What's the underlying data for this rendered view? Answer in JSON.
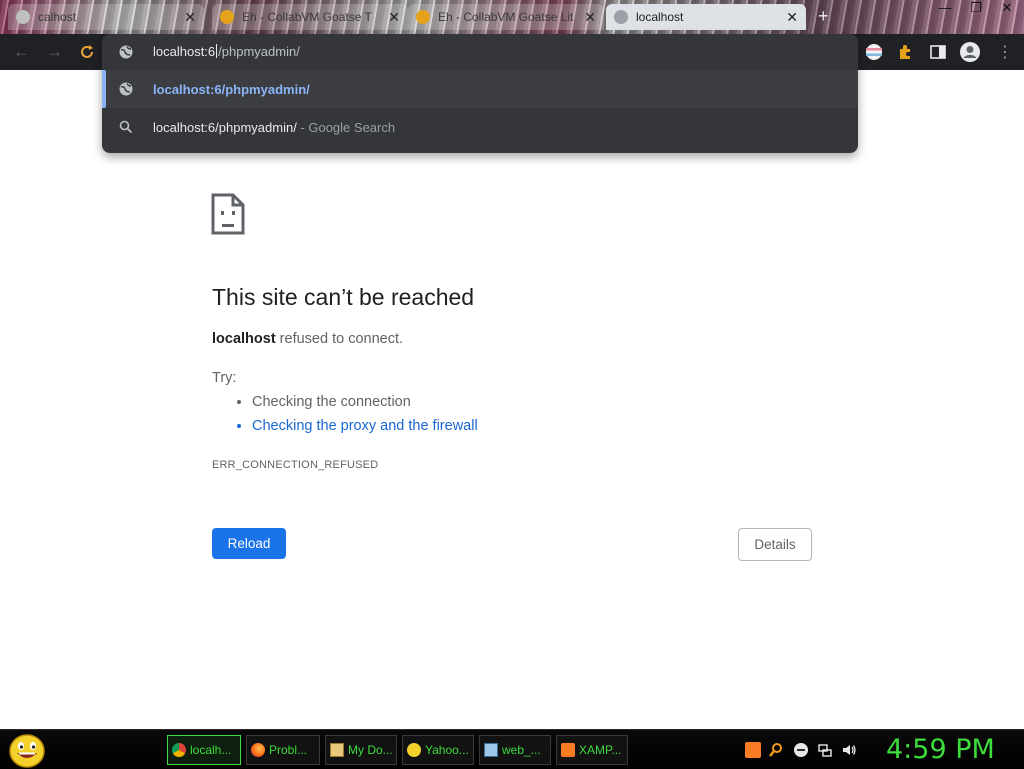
{
  "tabs": [
    {
      "title": "calhost",
      "active": false
    },
    {
      "title": "Eh - CollabVM Goatse T",
      "active": false
    },
    {
      "title": "Eh - CollabVM Goatse Lit",
      "active": false
    },
    {
      "title": "localhost",
      "active": true
    }
  ],
  "new_tab_label": "+",
  "window_controls": {
    "minimize": "—",
    "restore": "❐",
    "close": "✕"
  },
  "omnibox": {
    "typed_prefix": "localhost:6",
    "autocomplete": "/phpmyadmin/",
    "suggestions": [
      {
        "text": "localhost:6/phpmyadmin/",
        "suffix": "",
        "icon": "globe-icon",
        "selected": true
      },
      {
        "text": "localhost:6/phpmyadmin/",
        "suffix": " - Google Search",
        "icon": "search-icon",
        "selected": false
      }
    ]
  },
  "error_page": {
    "title": "This site can’t be reached",
    "host": "localhost",
    "message": " refused to connect.",
    "try_label": "Try:",
    "suggestions": [
      {
        "text": "Checking the connection",
        "link": false
      },
      {
        "text": "Checking the proxy and the firewall",
        "link": true
      }
    ],
    "error_code": "ERR_CONNECTION_REFUSED",
    "reload_label": "Reload",
    "details_label": "Details",
    "accent_color": "#1a73e8"
  },
  "taskbar": {
    "items": [
      {
        "label": "localh...",
        "icon": "chrome-icon",
        "active": true
      },
      {
        "label": "Probl...",
        "icon": "firefox-icon",
        "active": false
      },
      {
        "label": "My Do...",
        "icon": "documents-icon",
        "active": false
      },
      {
        "label": "Yahoo...",
        "icon": "yahoo-messenger-icon",
        "active": false
      },
      {
        "label": "web_...",
        "icon": "notepad-icon",
        "active": false
      },
      {
        "label": "XAMP...",
        "icon": "xampp-icon",
        "active": false
      }
    ],
    "tray_icons": [
      "xampp-tray-icon",
      "search-tray-icon",
      "minus-circle-tray-icon",
      "network-tray-icon",
      "volume-tray-icon"
    ],
    "clock": "4:59 PM",
    "clock_color": "#3ddc3d"
  }
}
